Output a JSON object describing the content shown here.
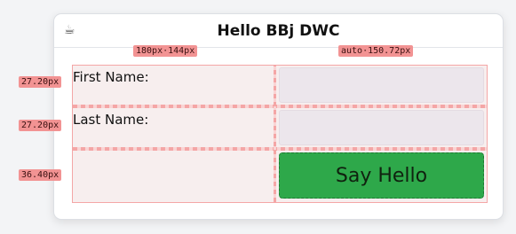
{
  "window": {
    "title": "Hello BBj DWC",
    "icon": "coffee-cup-icon"
  },
  "form": {
    "first_name_label": "First Name:",
    "last_name_label": "Last Name:",
    "first_name_value": "",
    "last_name_value": "",
    "button_label": "Say Hello"
  },
  "dev_overlay": {
    "column1_tag": "180px·144px",
    "column2_tag": "auto·150.72px",
    "row1_tag": "27.20px",
    "row2_tag": "27.20px",
    "row3_tag": "36.40px"
  },
  "colors": {
    "button_bg": "#2ea84a",
    "overlay": "#f29393",
    "input_bg": "#ece6ec"
  }
}
